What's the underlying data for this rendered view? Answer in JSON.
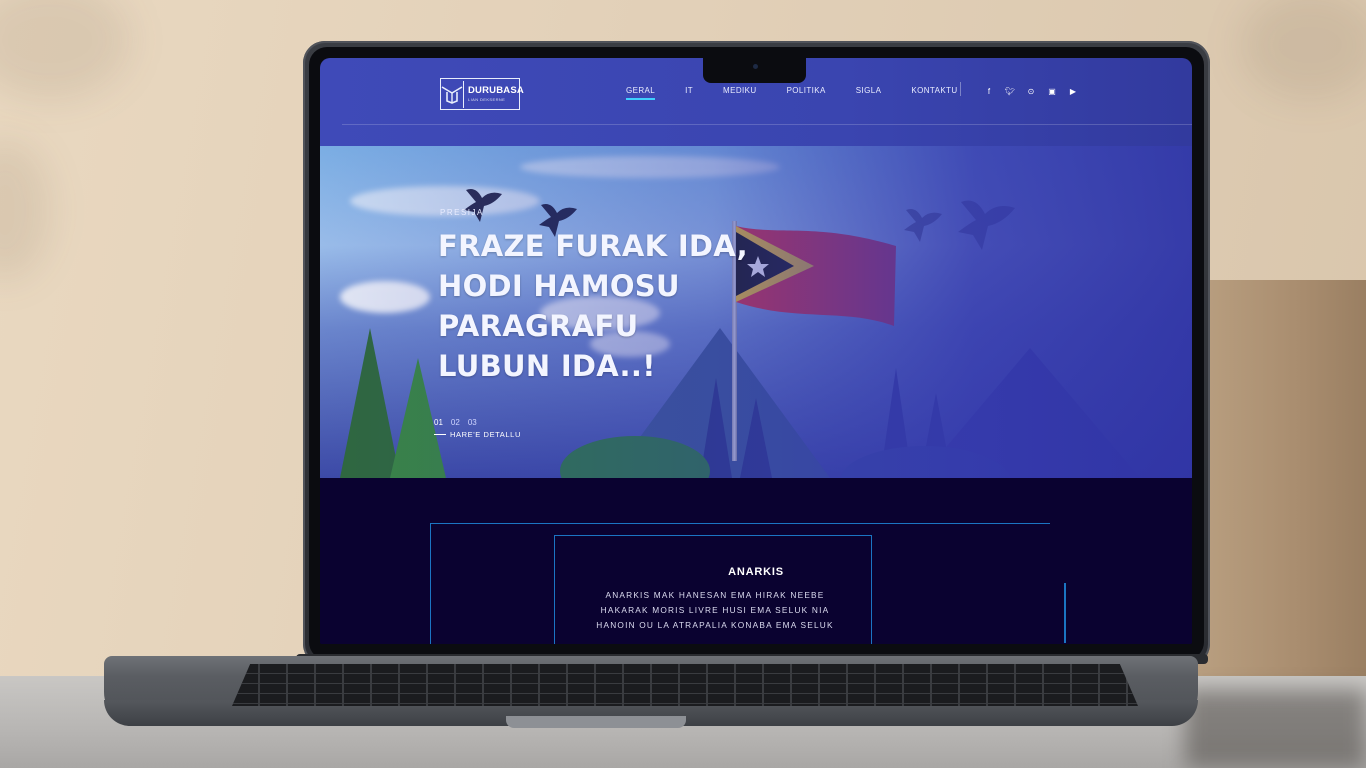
{
  "site": {
    "logo": {
      "title": "DURUBASA",
      "subtitle": "LIAN DEKSERNE"
    },
    "nav": [
      "GERAL",
      "IT",
      "MEDIKU",
      "POLITIKA",
      "SIGLA",
      "KONTAKTU"
    ],
    "active_nav": "GERAL",
    "social_icons": [
      "facebook-icon",
      "twitter-icon",
      "pinterest-icon",
      "instagram-icon",
      "youtube-icon"
    ]
  },
  "hero": {
    "eyebrow": "PRESIJA",
    "title_lines": [
      "FRAZE FURAK IDA,",
      "HODI HAMOSU",
      "PARAGRAFU",
      "LUBUN IDA..!"
    ],
    "pager": [
      "01",
      "02",
      "03"
    ],
    "active_slide": "01",
    "cta_label": "HARE'E DETALLU"
  },
  "section": {
    "title": "ANARKIS",
    "body_lines": [
      "ANARKIS MAK HANESAN EMA HIRAK NEEBE",
      "HAKARAK MORIS LIVRE HUSI EMA SELUK NIA",
      "HANOIN OU LA ATRAPALIA KONABA EMA SELUK"
    ]
  },
  "colors": {
    "header_bg": "#3f4ab8",
    "accent": "#3fd0ff",
    "dark_bg": "#0a0230",
    "frame": "#1b75c2"
  }
}
